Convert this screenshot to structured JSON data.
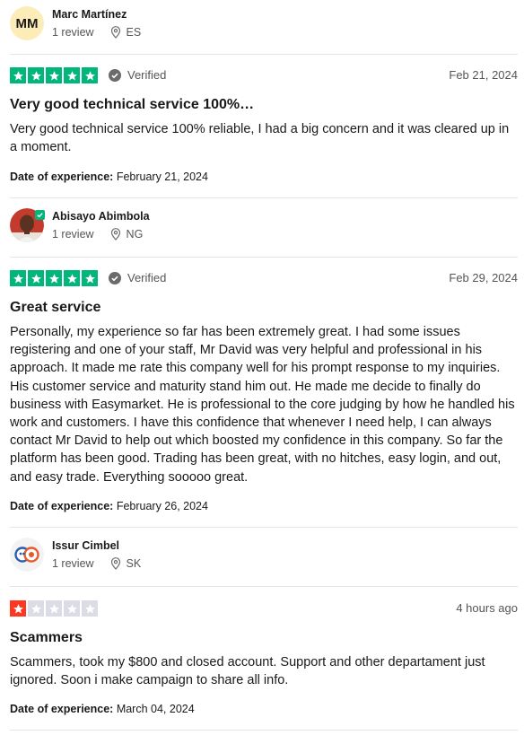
{
  "reviews": [
    {
      "reviewer": {
        "name": "Marc Martínez",
        "initials": "MM",
        "review_count": "1 review",
        "country": "ES"
      },
      "rating": 5,
      "verified_label": "Verified",
      "date": "Feb 21, 2024",
      "title": "Very good technical service 100%…",
      "body": "Very good technical service 100% reliable, I had a big concern and it was cleared up in a moment.",
      "experience_label": "Date of experience:",
      "experience_date": "February 21, 2024"
    },
    {
      "reviewer": {
        "name": "Abisayo Abimbola",
        "review_count": "1 review",
        "country": "NG"
      },
      "rating": 5,
      "verified_label": "Verified",
      "date": "Feb 29, 2024",
      "title": "Great service",
      "body": "Personally, my experience so far has been extremely great. I had some issues registering and one of your staff, Mr David was very helpful and professional in his approach. It made me rate this company well for his prompt response to my inquiries. His customer service and maturity stand him out. He made me decide to finally do business with Easymarket. He is professional to the core judging by how he handled his work and customers. I have this confidence that whenever I need help, I can always contact Mr David to help out which boosted my confidence in this company. So far the platform has been good. Trading has been great, with no hitches, easy login, and out, and easy trade. Everything sooooo great.",
      "experience_label": "Date of experience:",
      "experience_date": "February 26, 2024"
    },
    {
      "reviewer": {
        "name": "Issur Cimbel",
        "review_count": "1 review",
        "country": "SK"
      },
      "rating": 1,
      "date": "4 hours ago",
      "title": "Scammers",
      "body": "Scammers, took my $800 and closed account. Support and other departament just ignored. Soon i make campaign to share all info.",
      "experience_label": "Date of experience:",
      "experience_date": "March 04, 2024"
    }
  ],
  "colors": {
    "star_green": "#00b67a",
    "star_red": "#ff3722",
    "star_empty": "#dcdce6"
  },
  "icons": [
    "location-pin-icon",
    "verified-check-icon",
    "star-icon",
    "verified-badge-icon"
  ]
}
